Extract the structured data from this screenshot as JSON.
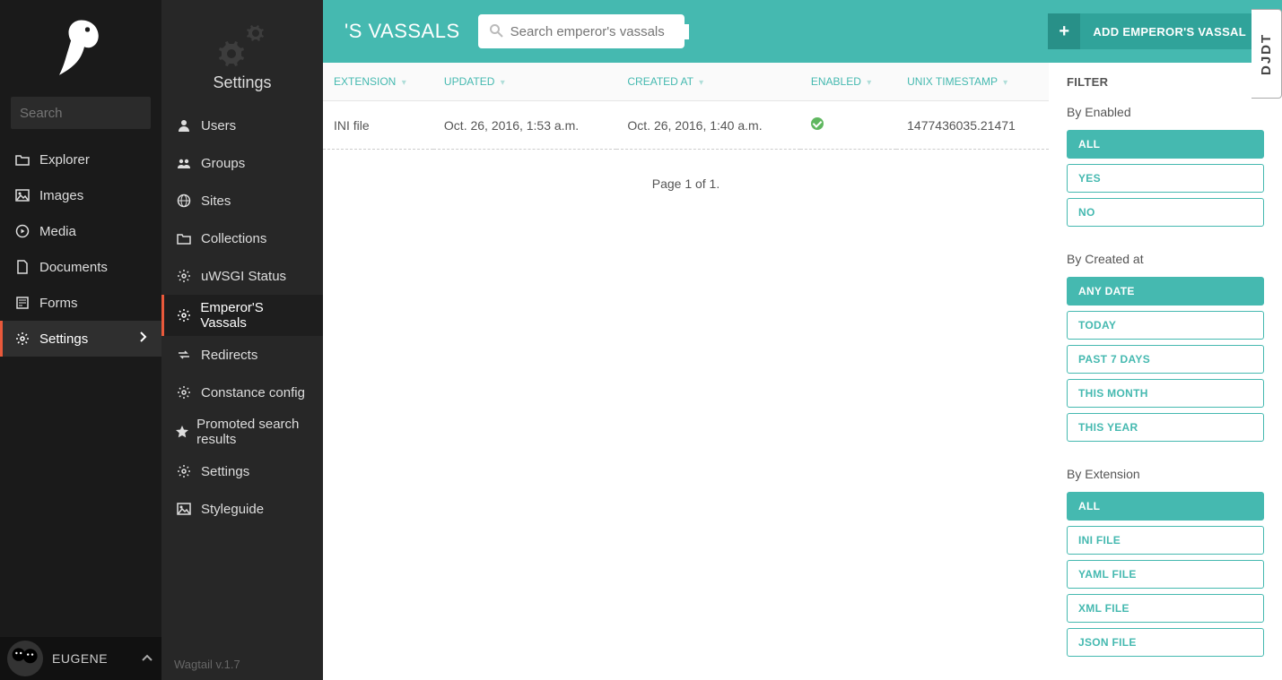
{
  "sidebar": {
    "search_placeholder": "Search",
    "items": [
      {
        "label": "Explorer",
        "icon": "folder-open-icon"
      },
      {
        "label": "Images",
        "icon": "image-icon"
      },
      {
        "label": "Media",
        "icon": "play-circle-icon"
      },
      {
        "label": "Documents",
        "icon": "file-icon"
      },
      {
        "label": "Forms",
        "icon": "form-icon"
      },
      {
        "label": "Settings",
        "icon": "gear-icon",
        "active": true,
        "has_children": true
      }
    ],
    "user_name": "EUGENE"
  },
  "settings_panel": {
    "title": "Settings",
    "items": [
      {
        "label": "Users",
        "icon": "user-icon"
      },
      {
        "label": "Groups",
        "icon": "group-icon"
      },
      {
        "label": "Sites",
        "icon": "globe-icon"
      },
      {
        "label": "Collections",
        "icon": "folder-open-icon"
      },
      {
        "label": "uWSGI Status",
        "icon": "cog-icon"
      },
      {
        "label": "Emperor'S Vassals",
        "icon": "cog-icon",
        "active": true
      },
      {
        "label": "Redirects",
        "icon": "redirect-icon"
      },
      {
        "label": "Constance config",
        "icon": "cog-icon"
      },
      {
        "label": "Promoted search results",
        "icon": "star-icon"
      },
      {
        "label": "Settings",
        "icon": "cog-icon"
      },
      {
        "label": "Styleguide",
        "icon": "image-icon"
      }
    ],
    "footer": "Wagtail v.1.7"
  },
  "header": {
    "title": "'S VASSALS",
    "search_placeholder": "Search emperor's vassals",
    "add_label": "ADD EMPEROR'S VASSAL"
  },
  "table": {
    "columns": [
      "EXTENSION",
      "UPDATED",
      "CREATED AT",
      "ENABLED",
      "UNIX TIMESTAMP"
    ],
    "rows": [
      {
        "extension": "INI file",
        "updated": "Oct. 26, 2016, 1:53 a.m.",
        "created_at": "Oct. 26, 2016, 1:40 a.m.",
        "enabled": true,
        "unix_timestamp": "1477436035.21471"
      }
    ],
    "pagination": "Page 1 of 1."
  },
  "filters": {
    "title": "FILTER",
    "groups": [
      {
        "title": "By Enabled",
        "options": [
          "ALL",
          "YES",
          "NO"
        ],
        "active": "ALL"
      },
      {
        "title": "By Created at",
        "options": [
          "ANY DATE",
          "TODAY",
          "PAST 7 DAYS",
          "THIS MONTH",
          "THIS YEAR"
        ],
        "active": "ANY DATE"
      },
      {
        "title": "By Extension",
        "options": [
          "ALL",
          "INI FILE",
          "YAML FILE",
          "XML FILE",
          "JSON FILE"
        ],
        "active": "ALL"
      }
    ]
  },
  "djdt_label": "DJDT"
}
